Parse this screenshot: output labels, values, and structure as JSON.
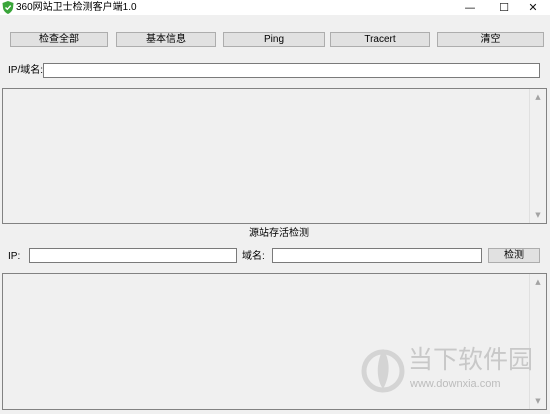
{
  "window": {
    "title": "360网站卫士检测客户端1.0",
    "minimize": "—",
    "maximize": "☐",
    "close": "✕"
  },
  "toolbar": {
    "check_all": "检查全部",
    "basic_info": "基本信息",
    "ping": "Ping",
    "tracert": "Tracert",
    "clear": "清空"
  },
  "domain_field": {
    "label": "IP/域名:",
    "value": ""
  },
  "source_check": {
    "section_title": "源站存活检测",
    "ip_label": "IP:",
    "ip_value": "",
    "domain_label": "域名:",
    "domain_value": "",
    "check_button": "检测"
  },
  "watermark": {
    "brand": "当下软件园",
    "url": "www.downxia.com"
  },
  "colors": {
    "app_icon": "#3aa53a",
    "watermark": "#c9c9c9"
  }
}
